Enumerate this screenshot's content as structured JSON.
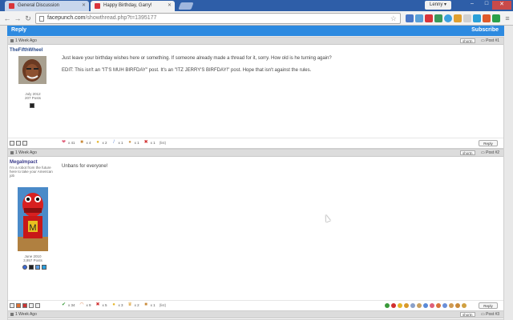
{
  "browser": {
    "tabs": [
      {
        "title": "General Discussion",
        "active": false
      },
      {
        "title": "Happy Birthday, Garry!",
        "active": true
      }
    ],
    "user": "Lenny",
    "url_host": "facepunch.com",
    "url_path": "/showthread.php?t=1395177"
  },
  "bar": {
    "reply": "Reply",
    "subscribe": "Subscribe"
  },
  "posts": [
    {
      "date": "1 Week Ago",
      "shortn": "shortn",
      "postnum": "Post #1",
      "username": "TheFifthWheel",
      "usertitle": "",
      "joined": "July 2012",
      "postcount": "207 Posts",
      "lines": [
        "Just leave your birthday wishes here or something. If someone already made a thread for it, sorry. How old is he turning again?",
        "EDIT: This isn't an \"IT'S MUH BIRFDAY\" post. It's an \"ITZ JERRY'S BIRFDAY!\" post. Hope that isn't against the rules."
      ],
      "ratings": [
        {
          "icon": "heart-icon",
          "glyph": "❤",
          "color": "#e0607a",
          "count": "x 41"
        },
        {
          "icon": "box-icon",
          "glyph": "■",
          "color": "#c98a3a",
          "count": "x 4"
        },
        {
          "icon": "funny-icon",
          "glyph": "●",
          "color": "#e5b52a",
          "count": "x 2"
        },
        {
          "icon": "brush-icon",
          "glyph": "/",
          "color": "#6b8fd8",
          "count": "x 1"
        },
        {
          "icon": "cookie-icon",
          "glyph": "●",
          "color": "#d09a50",
          "count": "x 1"
        },
        {
          "icon": "cross-icon",
          "glyph": "✖",
          "color": "#d12f2f",
          "count": "x 1"
        }
      ],
      "list_link": "(list)",
      "reply": "Reply"
    },
    {
      "date": "1 Week Ago",
      "shortn": "shortn",
      "postnum": "Post #2",
      "username": "MegaImpact",
      "usertitle": "I'm a robot from the future here to take your American job",
      "joined": "June 2010",
      "postcount": "3,957 Posts",
      "lines": [
        "Unbans for everyone!"
      ],
      "ratings": [
        {
          "icon": "check-icon",
          "glyph": "✔",
          "color": "#3a9a3a",
          "count": "x 34"
        },
        {
          "icon": "rainbow-icon",
          "glyph": "◠",
          "color": "#d9743a",
          "count": "x 9"
        },
        {
          "icon": "cross-icon",
          "glyph": "✖",
          "color": "#d12f2f",
          "count": "x 5"
        },
        {
          "icon": "funny-icon",
          "glyph": "●",
          "color": "#e5b52a",
          "count": "x 3"
        },
        {
          "icon": "winner-icon",
          "glyph": "♛",
          "color": "#d99a2a",
          "count": "x 2"
        },
        {
          "icon": "box-icon",
          "glyph": "■",
          "color": "#c98a3a",
          "count": "x 1"
        }
      ],
      "list_link": "(list)",
      "reply": "Reply"
    },
    {
      "date": "1 Week Ago",
      "shortn": "shortn",
      "postnum": "Post #3"
    }
  ]
}
